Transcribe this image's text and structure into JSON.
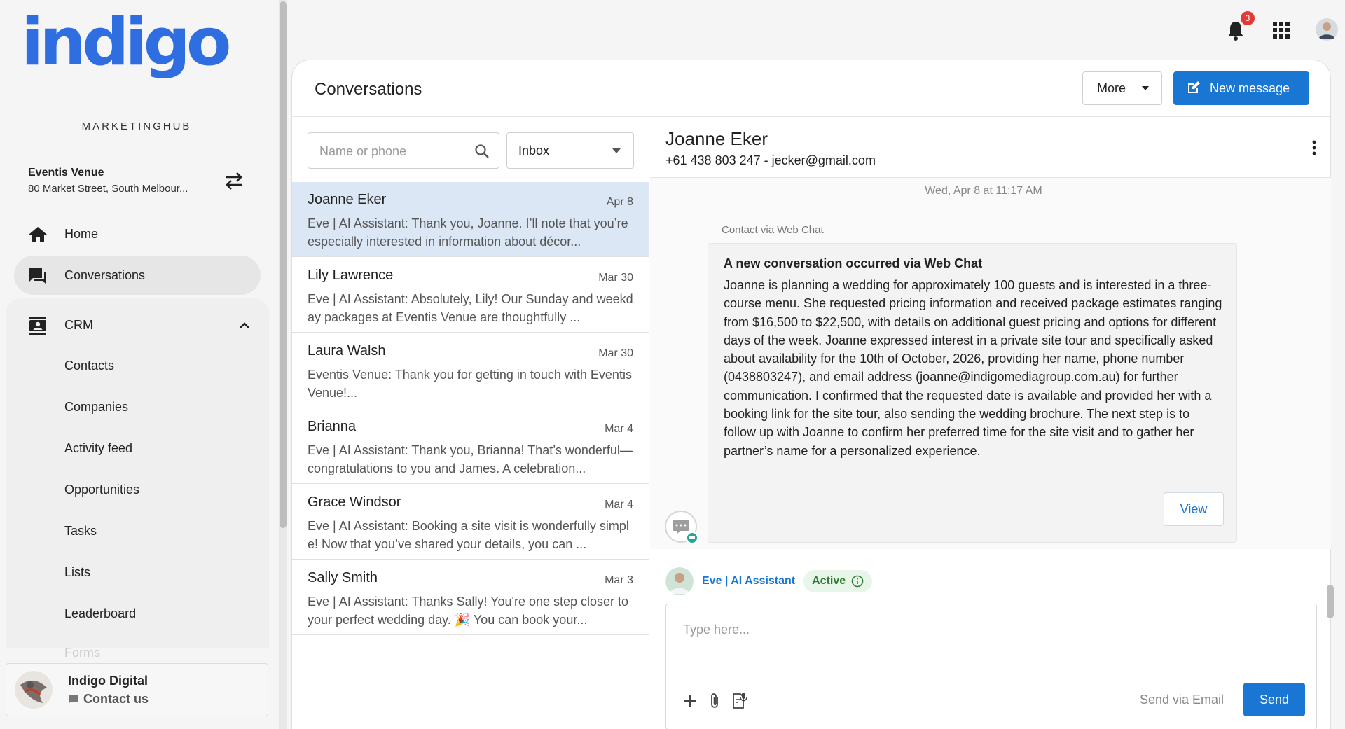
{
  "brand": {
    "logo_text": "indigo",
    "logo_sub": "MARKETINGHUB",
    "accent": "#1976d2",
    "logo_color": "#2f6ee0"
  },
  "venue": {
    "name": "Eventis Venue",
    "address": "80 Market Street, South Melbour..."
  },
  "nav": {
    "home": "Home",
    "conversations": "Conversations",
    "crm": "CRM",
    "crm_items": [
      "Contacts",
      "Companies",
      "Activity feed",
      "Opportunities",
      "Tasks",
      "Lists",
      "Leaderboard"
    ],
    "faded_item": "Forms"
  },
  "account": {
    "org_name": "Indigo Digital",
    "contact_us": "Contact us"
  },
  "topbar": {
    "notification_count": "3",
    "icons": [
      "bell-icon",
      "apps-grid-icon",
      "user-avatar"
    ]
  },
  "conversations": {
    "title": "Conversations",
    "more_label": "More",
    "new_message_label": "New message",
    "search_placeholder": "Name or phone",
    "filter_value": "Inbox",
    "items": [
      {
        "name": "Joanne Eker",
        "date": "Apr 8",
        "preview": "Eve | AI Assistant: Thank you, Joanne. I’ll note that you’re especially interested in information about décor..."
      },
      {
        "name": "Lily Lawrence",
        "date": "Mar 30",
        "preview": "Eve | AI Assistant: Absolutely, Lily! Our Sunday and weekday packages at Eventis Venue are thoughtfully ..."
      },
      {
        "name": "Laura Walsh",
        "date": "Mar 30",
        "preview": "Eventis Venue: Thank you for getting in touch with Eventis Venue!..."
      },
      {
        "name": "Brianna",
        "date": "Mar 4",
        "preview": "Eve | AI Assistant: Thank you, Brianna! That’s wonderful—congratulations to you and James. A celebration..."
      },
      {
        "name": "Grace Windsor",
        "date": "Mar 4",
        "preview": "Eve | AI Assistant: Booking a site visit is wonderfully simple! Now that you’ve shared your details, you can ..."
      },
      {
        "name": "Sally Smith",
        "date": "Mar 3",
        "preview": "Eve | AI Assistant: Thanks Sally! You're one step closer to your perfect wedding day. 🎉 You can book your..."
      }
    ]
  },
  "detail": {
    "contact_name": "Joanne Eker",
    "contact_info": "+61 438 803 247 - jecker@gmail.com",
    "date_separator": "Wed, Apr 8 at 11:17 AM",
    "via_label": "Contact via Web Chat",
    "card_heading": "A new conversation occurred via Web Chat",
    "card_body": "Joanne is planning a wedding for approximately 100 guests and is interested in a three-course menu. She requested pricing information and received package estimates ranging from $16,500 to $22,500, with details on additional guest pricing and options for different days of the week. Joanne expressed interest in a private site tour and specifically asked about availability for the 10th of October, 2026, providing her name, phone number (0438803247), and email address (joanne@indigomediagroup.com.au) for further communication. I confirmed that the requested date is available and provided her with a booking link for the site tour, also sending the wedding brochure. The next step is to follow up with Joanne to confirm her preferred time for the site visit and to gather her partner’s name for a personalized experience.",
    "view_label": "View",
    "assistant_name": "Eve | AI Assistant",
    "assistant_status": "Active",
    "composer_placeholder": "Type here...",
    "send_via_label": "Send via Email",
    "send_label": "Send"
  }
}
